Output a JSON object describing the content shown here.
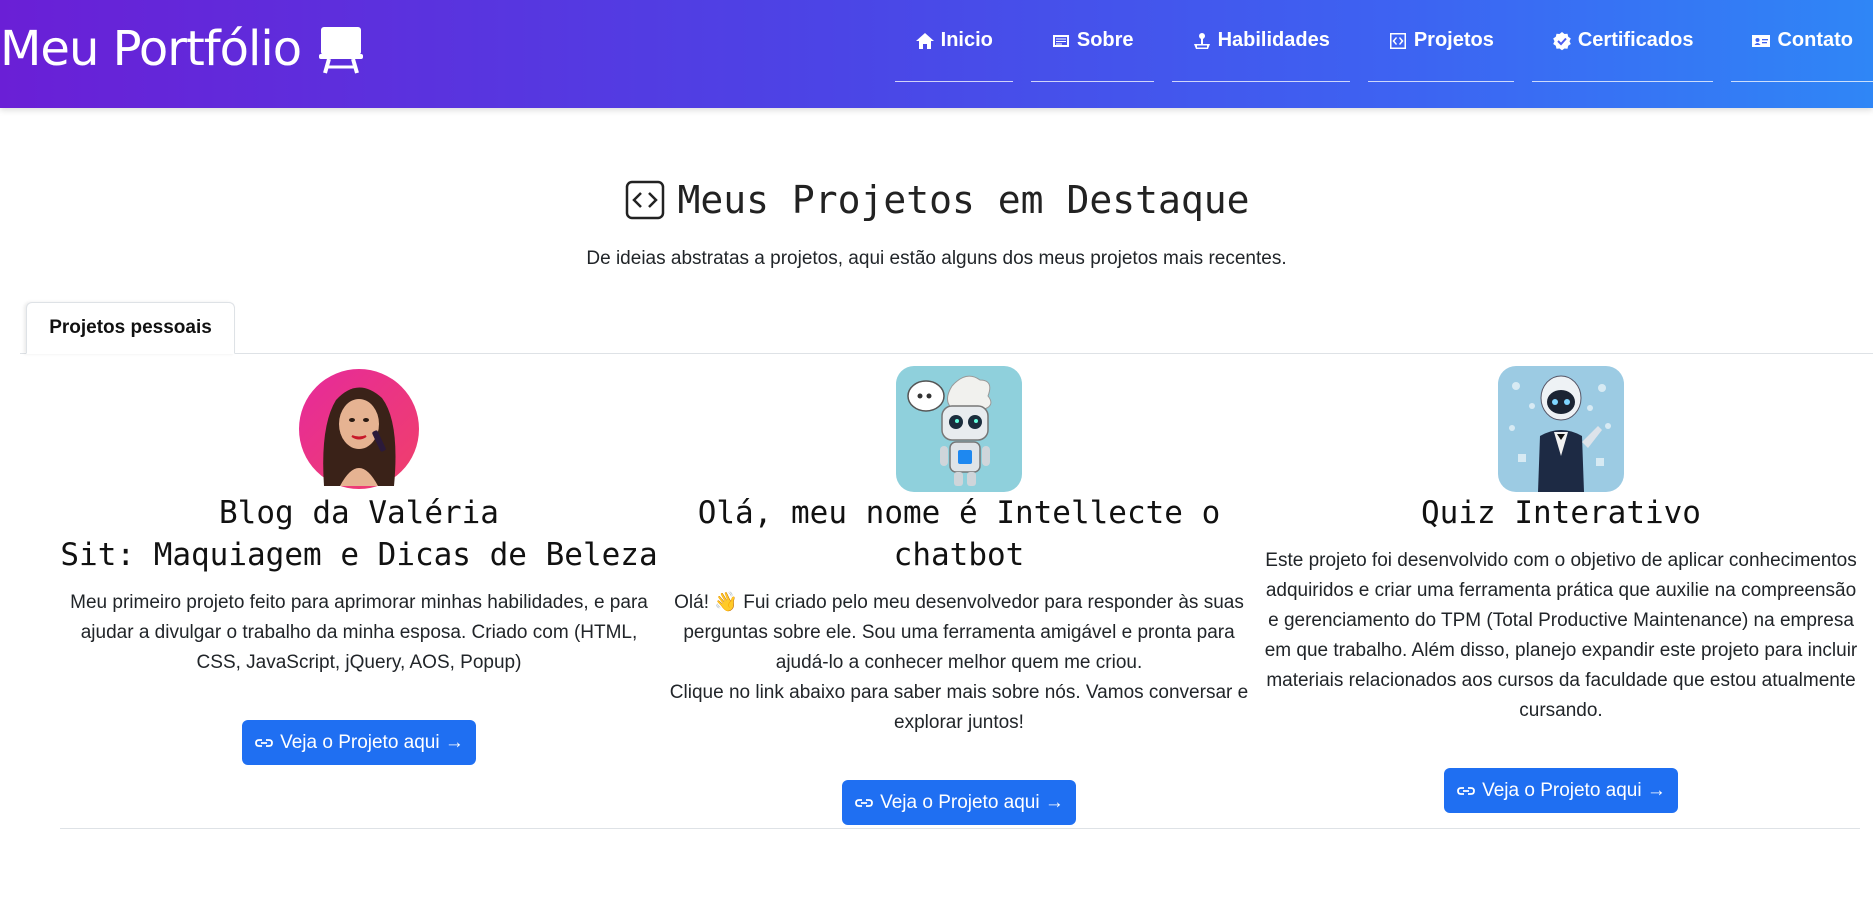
{
  "header": {
    "brand": "Meu Portfólio",
    "nav": [
      {
        "label": "Inicio",
        "icon": "house-icon"
      },
      {
        "label": "Sobre",
        "icon": "card-text-icon"
      },
      {
        "label": "Habilidades",
        "icon": "joystick-icon"
      },
      {
        "label": "Projetos",
        "icon": "code-square-icon"
      },
      {
        "label": "Certificados",
        "icon": "patch-check-icon"
      },
      {
        "label": "Contato",
        "icon": "contact-card-icon"
      }
    ],
    "colors": {
      "gradient_start": "#6a1fd6",
      "gradient_end": "#2f86f6"
    }
  },
  "section": {
    "title": "Meus Projetos em Destaque",
    "subtitle": "De ideias abstratas a projetos, aqui estão alguns dos meus projetos mais recentes."
  },
  "tabs": [
    {
      "label": "Projetos pessoais",
      "active": true
    }
  ],
  "projects": [
    {
      "title": "Blog da Valéria\nSit: Maquiagem e Dicas de Beleza",
      "description": "Meu primeiro projeto feito para aprimorar minhas habilidades, e para ajudar a divulgar o trabalho da minha esposa. Criado com (HTML, CSS, JavaScript, jQuery, AOS, Popup)",
      "button": "Veja o Projeto aqui →",
      "image": "makeup-artist-avatar"
    },
    {
      "title": "Olá, meu nome é Intellecte o chatbot",
      "description": "Olá! 👋 Fui criado pelo meu desenvolvedor para responder às suas perguntas sobre ele. Sou uma ferramenta amigável e pronta para ajudá-lo a conhecer melhor quem me criou.\nClique no link abaixo para saber mais sobre nós. Vamos conversar e explorar juntos!",
      "button": "Veja o Projeto aqui →",
      "image": "chatbot-robot"
    },
    {
      "title": "Quiz Interativo",
      "description": "Este projeto foi desenvolvido com o objetivo de aplicar conhecimentos adquiridos e criar uma ferramenta prática que auxilie na compreensão e gerenciamento do TPM (Total Productive Maintenance) na empresa em que trabalho. Além disso, planejo expandir este projeto para incluir materiais relacionados aos cursos da faculdade que estou atualmente cursando.",
      "button": "Veja o Projeto aqui →",
      "image": "robot-quiz"
    }
  ],
  "accent": "#1f6ff2"
}
